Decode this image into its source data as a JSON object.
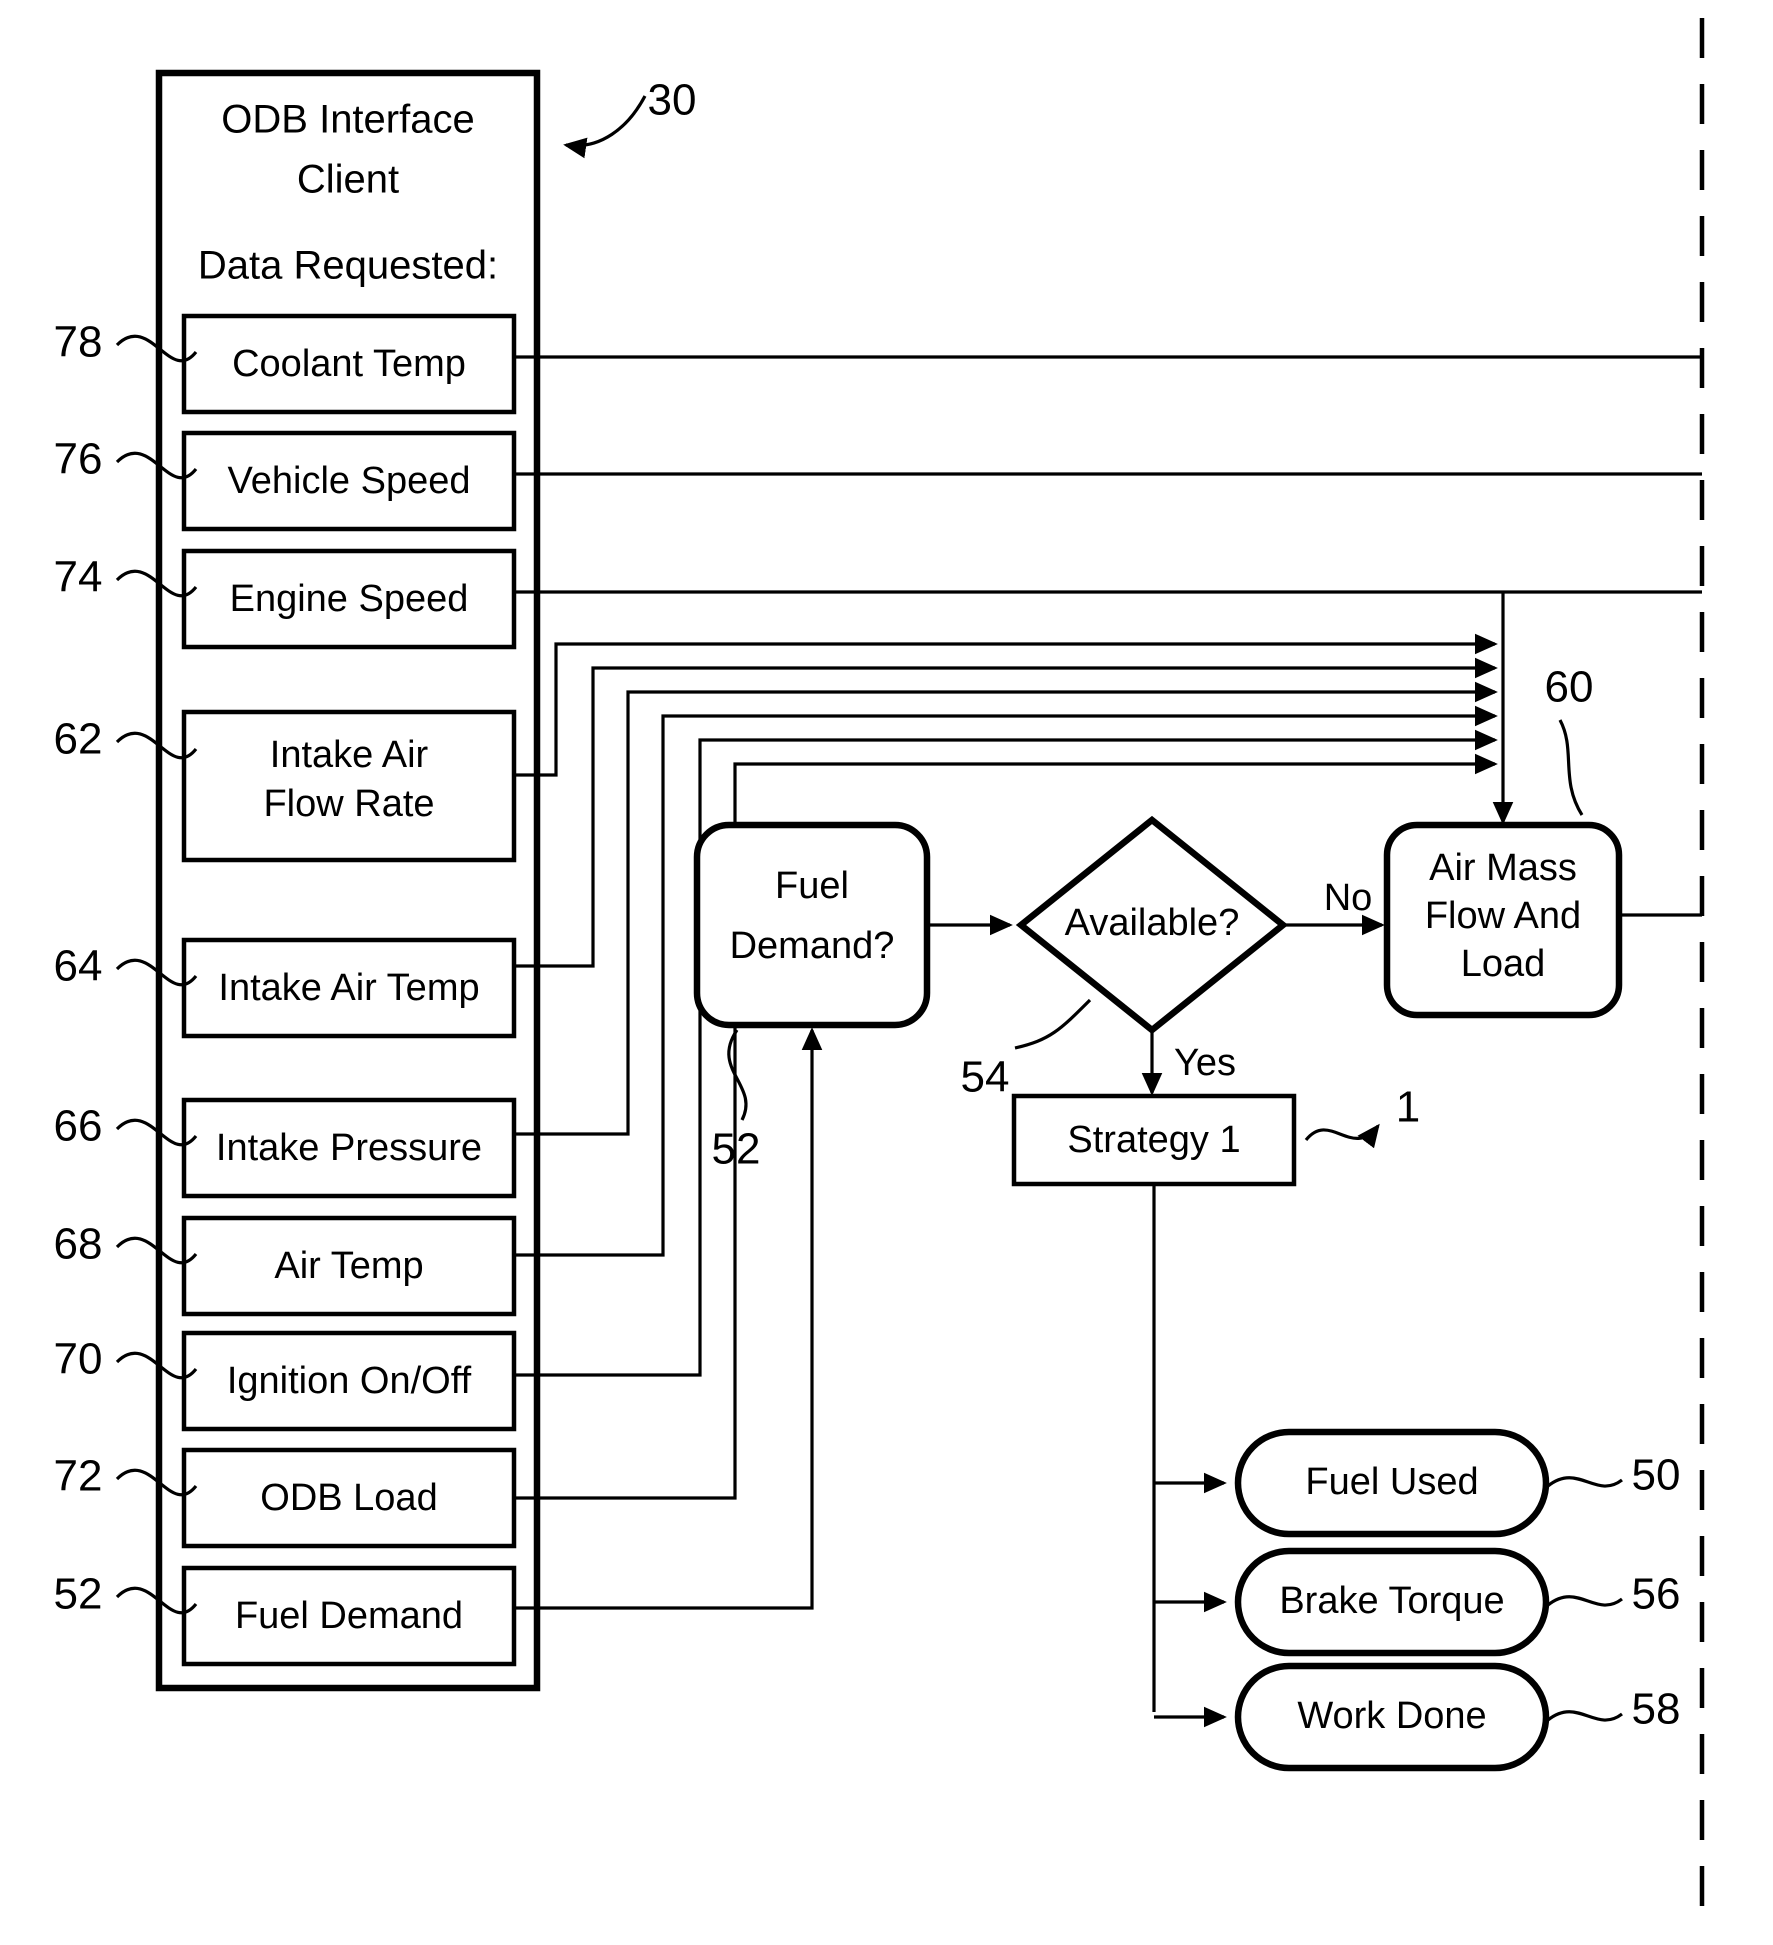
{
  "figure": {
    "type": "patent-flow-diagram",
    "overall_ref": "30"
  },
  "client_panel": {
    "title_line1": "ODB Interface",
    "title_line2": "Client",
    "subtitle": "Data Requested:",
    "items": [
      {
        "ref": "78",
        "label": "Coolant Temp",
        "lines": [
          "Coolant Temp"
        ]
      },
      {
        "ref": "76",
        "label": "Vehicle Speed",
        "lines": [
          "Vehicle Speed"
        ]
      },
      {
        "ref": "74",
        "label": "Engine Speed",
        "lines": [
          "Engine Speed"
        ]
      },
      {
        "ref": "62",
        "label": "Intake Air Flow Rate",
        "lines": [
          "Intake Air",
          "Flow Rate"
        ]
      },
      {
        "ref": "64",
        "label": "Intake Air Temp",
        "lines": [
          "Intake Air Temp"
        ]
      },
      {
        "ref": "66",
        "label": "Intake Pressure",
        "lines": [
          "Intake Pressure"
        ]
      },
      {
        "ref": "68",
        "label": "Air Temp",
        "lines": [
          "Air Temp"
        ]
      },
      {
        "ref": "70",
        "label": "Ignition On/Off",
        "lines": [
          "Ignition On/Off"
        ]
      },
      {
        "ref": "72",
        "label": "ODB Load",
        "lines": [
          "ODB Load"
        ]
      },
      {
        "ref": "52",
        "label": "Fuel Demand",
        "lines": [
          "Fuel Demand"
        ]
      }
    ]
  },
  "process": {
    "fuel_demand": {
      "ref": "52",
      "lines": [
        "Fuel",
        "Demand?"
      ]
    },
    "decision": {
      "ref": "54",
      "label": "Available?",
      "branch_no": "No",
      "branch_yes": "Yes"
    },
    "air_mass": {
      "ref": "60",
      "lines": [
        "Air Mass",
        "Flow And",
        "Load"
      ]
    },
    "strategy": {
      "ref": "1",
      "label": "Strategy 1"
    }
  },
  "outputs": [
    {
      "ref": "50",
      "label": "Fuel Used"
    },
    {
      "ref": "56",
      "label": "Brake Torque"
    },
    {
      "ref": "58",
      "label": "Work Done"
    }
  ],
  "colors": {
    "ink": "#000000",
    "paper": "#ffffff"
  }
}
